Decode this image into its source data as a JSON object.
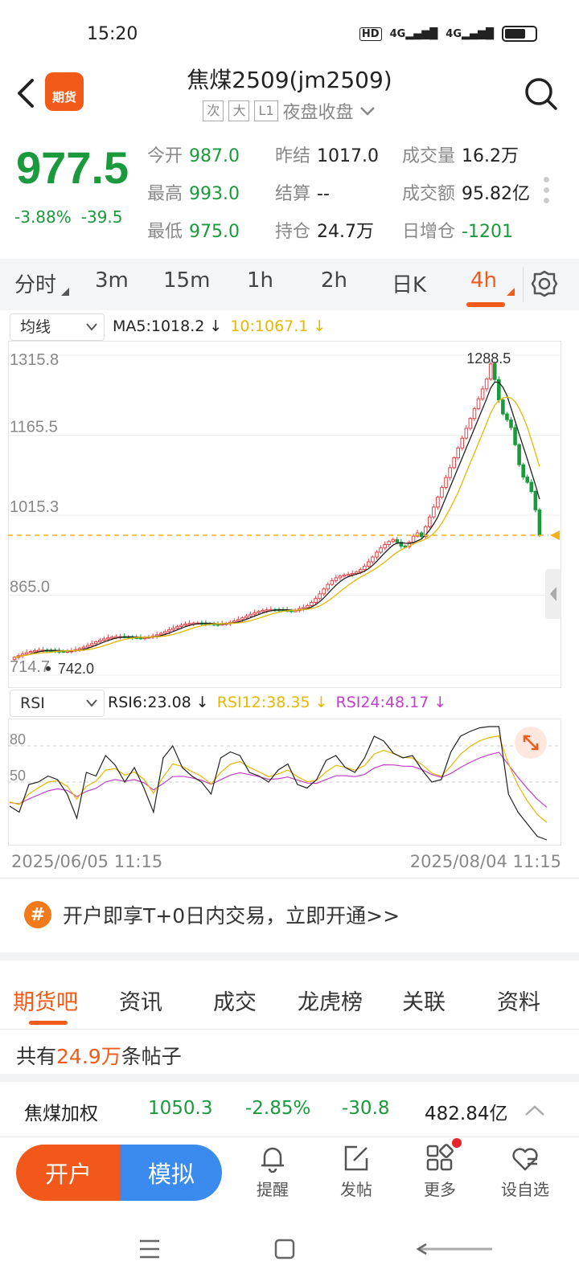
{
  "status_bar": {
    "time": "15:20",
    "hd": "HD",
    "net1": "4G",
    "net2": "4G"
  },
  "header": {
    "logo_text": "期货",
    "title": "焦煤2509(jm2509)",
    "tags": [
      "次",
      "大",
      "L1"
    ],
    "session": "夜盘收盘"
  },
  "quote": {
    "price": "977.5",
    "change_pct": "-3.88%",
    "change": "-39.5",
    "stats": [
      {
        "k": "今开",
        "v": "987.0",
        "color": "green"
      },
      {
        "k": "昨结",
        "v": "1017.0",
        "color": "black"
      },
      {
        "k": "成交量",
        "v": "16.2万",
        "color": "black"
      },
      {
        "k": "最高",
        "v": "993.0",
        "color": "green"
      },
      {
        "k": "结算",
        "v": "--",
        "color": "black"
      },
      {
        "k": "成交额",
        "v": "95.82亿",
        "color": "black"
      },
      {
        "k": "最低",
        "v": "975.0",
        "color": "green"
      },
      {
        "k": "持仓",
        "v": "24.7万",
        "color": "black"
      },
      {
        "k": "日增仓",
        "v": "-1201",
        "color": "green"
      }
    ]
  },
  "period_tabs": [
    "分时",
    "3m",
    "15m",
    "1h",
    "2h",
    "日K",
    "4h"
  ],
  "active_period": "4h",
  "ma_bar": {
    "dropdown": "均线",
    "ma5": "MA5:1018.2 ↓",
    "ma10": "10:1067.1 ↓"
  },
  "kline": {
    "y_labels": [
      "1315.8",
      "1165.5",
      "1015.3",
      "865.0",
      "714.7"
    ],
    "y_values": [
      1315.8,
      1165.5,
      1015.3,
      865.0,
      714.7
    ],
    "high_label": "1288.5",
    "low_label": "742.0",
    "last_price": 977.5,
    "colors": {
      "up": "#e0454a",
      "down": "#1a9a3c",
      "ma5": "#222222",
      "ma10": "#e6b800",
      "last": "#f2b01a"
    }
  },
  "rsi_bar": {
    "dropdown": "RSI",
    "rsi6": "RSI6:23.08 ↓",
    "rsi12": "RSI12:38.35 ↓",
    "rsi24": "RSI24:48.17 ↓"
  },
  "rsi": {
    "labels": [
      "80",
      "50"
    ],
    "colors": {
      "rsi6": "#222222",
      "rsi12": "#e6b800",
      "rsi24": "#c040c8"
    }
  },
  "dates": {
    "start": "2025/06/05 11:15",
    "end": "2025/08/04 11:15"
  },
  "promo": {
    "icon": "#",
    "text": "开户即享T+0日内交易，立即开通>>"
  },
  "bottom_tabs": [
    "期货吧",
    "资讯",
    "成交",
    "龙虎榜",
    "关联",
    "资料"
  ],
  "posts": {
    "prefix": "共有",
    "count": "24.9万",
    "suffix": "条帖子"
  },
  "index_row": {
    "name": "焦煤加权",
    "price": "1050.3",
    "pct": "-2.85%",
    "chg": "-30.8",
    "amount": "482.84亿"
  },
  "actions": {
    "open": "开户",
    "simulate": "模拟"
  },
  "nav": [
    {
      "icon": "bell-icon",
      "label": "提醒"
    },
    {
      "icon": "edit-icon",
      "label": "发帖"
    },
    {
      "icon": "grid-icon",
      "label": "更多"
    },
    {
      "icon": "heart-icon",
      "label": "设自选"
    }
  ]
}
